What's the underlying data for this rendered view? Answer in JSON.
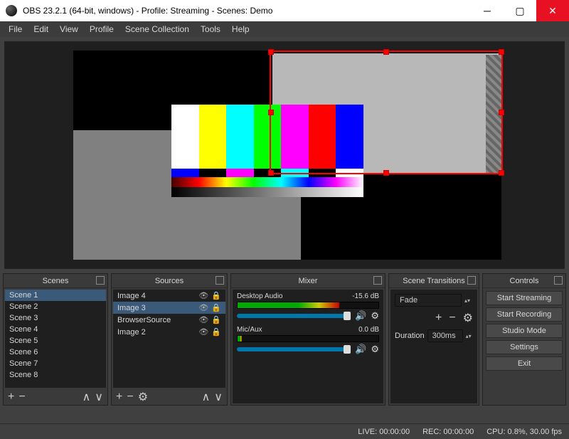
{
  "titlebar": {
    "title": "OBS 23.2.1 (64-bit, windows) - Profile: Streaming - Scenes: Demo"
  },
  "menu": {
    "items": [
      "File",
      "Edit",
      "View",
      "Profile",
      "Scene Collection",
      "Tools",
      "Help"
    ]
  },
  "panels": {
    "scenes": {
      "title": "Scenes",
      "items": [
        "Scene 1",
        "Scene 2",
        "Scene 3",
        "Scene 4",
        "Scene 5",
        "Scene 6",
        "Scene 7",
        "Scene 8"
      ],
      "selected": 0
    },
    "sources": {
      "title": "Sources",
      "items": [
        "Image 4",
        "Image 3",
        "BrowserSource",
        "Image 2"
      ],
      "selected": 1
    },
    "mixer": {
      "title": "Mixer",
      "channels": [
        {
          "name": "Desktop Audio",
          "level": "-15.6 dB",
          "fill": 72
        },
        {
          "name": "Mic/Aux",
          "level": "0.0 dB",
          "fill": 3
        }
      ]
    },
    "transitions": {
      "title": "Scene Transitions",
      "current": "Fade",
      "duration_label": "Duration",
      "duration_value": "300ms"
    },
    "controls": {
      "title": "Controls",
      "buttons": [
        "Start Streaming",
        "Start Recording",
        "Studio Mode",
        "Settings",
        "Exit"
      ]
    }
  },
  "statusbar": {
    "live": "LIVE: 00:00:00",
    "rec": "REC: 00:00:00",
    "cpu": "CPU: 0.8%, 30.00 fps"
  }
}
